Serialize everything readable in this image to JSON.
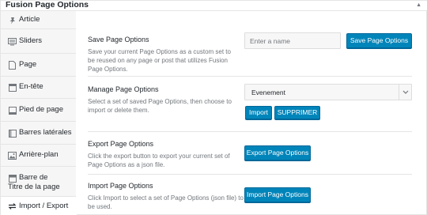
{
  "panel": {
    "title": "Fusion Page Options",
    "collapse_icon": "triangle-up-icon"
  },
  "sidebar": {
    "items": [
      {
        "label": "Article",
        "icon": "pin-icon",
        "active": false
      },
      {
        "label": "Sliders",
        "icon": "slides-icon",
        "active": false
      },
      {
        "label": "Page",
        "icon": "page-icon",
        "active": false
      },
      {
        "label": "En-tête",
        "icon": "header-icon",
        "active": false
      },
      {
        "label": "Pied de page",
        "icon": "footer-icon",
        "active": false
      },
      {
        "label": "Barres latérales",
        "icon": "sidebar-icon",
        "active": false
      },
      {
        "label": "Arrière-plan",
        "icon": "image-icon",
        "active": false
      },
      {
        "label": "Barre de Titre de la page",
        "icon": "titlebar-icon",
        "active": false
      },
      {
        "label": "Import / Export",
        "icon": "import-export-icon",
        "active": true
      }
    ]
  },
  "save": {
    "title": "Save Page Options",
    "description": "Save your current Page Options as a custom set to be reused on any page or post that utilizes Fusion Page Options.",
    "input_placeholder": "Enter a name",
    "button_label": "Save Page Options"
  },
  "manage": {
    "title": "Manage Page Options",
    "description": "Select a set of saved Page Options, then choose to import or delete them.",
    "selected_option": "Evenement",
    "import_label": "Import",
    "delete_label": "SUPPRIMER"
  },
  "export": {
    "title": "Export Page Options",
    "description": "Click the export button to export your current set of Page Options as a json file.",
    "button_label": "Export Page Options"
  },
  "import": {
    "title": "Import Page Options",
    "description": "Click Import to select a set of Page Options (json file) to be used.",
    "button_label": "Import Page Options"
  },
  "colors": {
    "primary_button": "#0085ba",
    "sidebar_bg": "#f6f6f6",
    "border": "#e5e5e5"
  }
}
